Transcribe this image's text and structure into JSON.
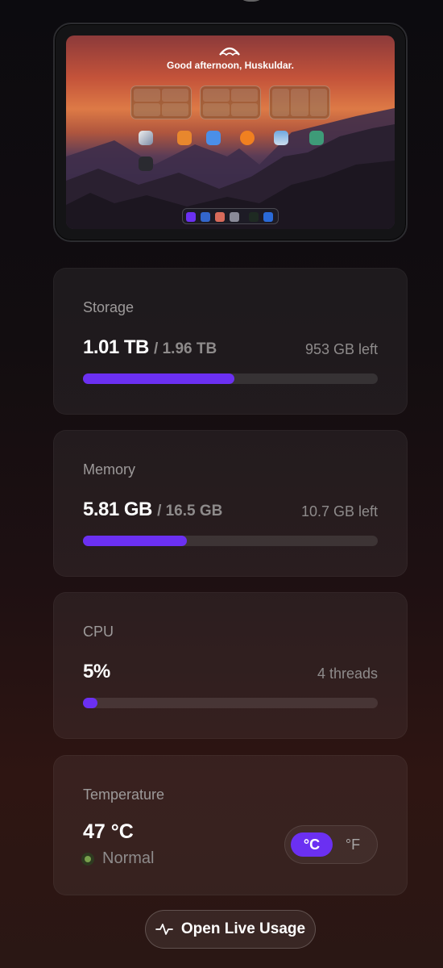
{
  "preview": {
    "greeting": "Good afternoon, Huskuldar."
  },
  "storage": {
    "title": "Storage",
    "used": "1.01 TB",
    "total": "/ 1.96 TB",
    "left": "953 GB left",
    "fraction": 0.515
  },
  "memory": {
    "title": "Memory",
    "used": "5.81 GB",
    "total": "/ 16.5 GB",
    "left": "10.7 GB left",
    "fraction": 0.352
  },
  "cpu": {
    "title": "CPU",
    "used": "5%",
    "threads": "4 threads",
    "fraction": 0.05
  },
  "temperature": {
    "title": "Temperature",
    "value": "47 °C",
    "status": "Normal",
    "unit_c": "°C",
    "unit_f": "°F",
    "selected_unit": "C"
  },
  "live_button": {
    "label": "Open Live Usage",
    "icon": "activity-icon"
  },
  "colors": {
    "accent": "#6b30f2",
    "status_ok": "#78a04c"
  }
}
